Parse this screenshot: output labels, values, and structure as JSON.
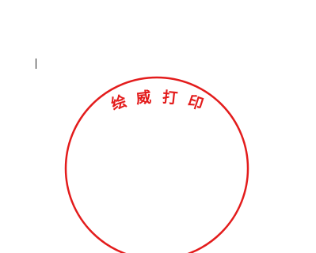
{
  "document": {
    "stamp": {
      "text": "绘威打印",
      "characters": [
        "绘",
        "威",
        "打",
        "印"
      ],
      "color": "#e31c1c"
    }
  }
}
